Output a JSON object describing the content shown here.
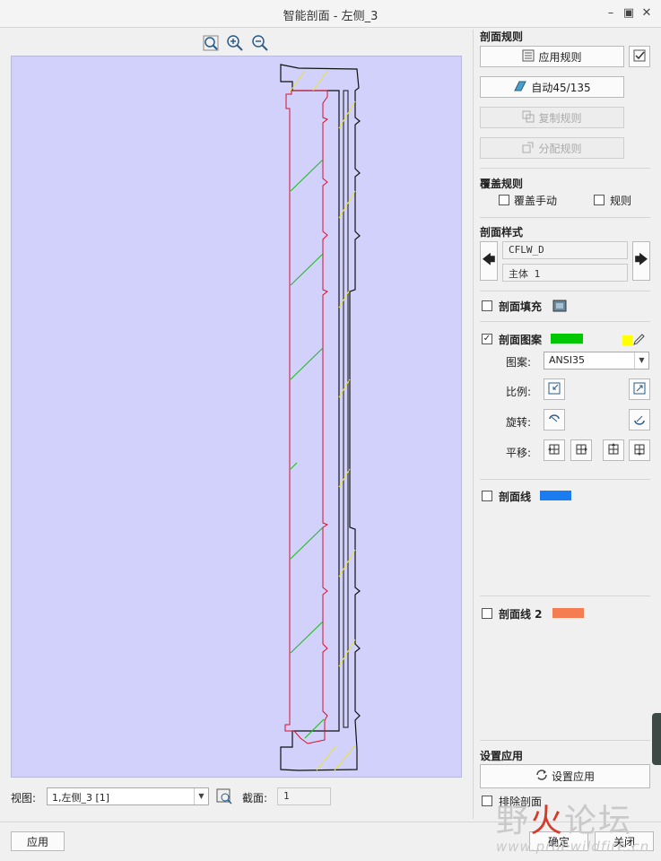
{
  "window": {
    "title": "智能剖面 - 左侧_3"
  },
  "rules": {
    "header": "剖面规则",
    "apply_rules": "应用规则",
    "auto": "自动45/135",
    "copy_rules": "复制规则",
    "assign_rules": "分配规则"
  },
  "override": {
    "header": "覆盖规则",
    "manual": "覆盖手动",
    "rule": "规则"
  },
  "style": {
    "header": "剖面样式",
    "name": "CFLW_D",
    "body": "主体 1"
  },
  "fill": {
    "label": "剖面填充",
    "checked": false
  },
  "pattern": {
    "label": "剖面图案",
    "checked": true,
    "color": "#00c800",
    "edit_color": "#ffff00",
    "pattern_label": "图案:",
    "pattern_value": "ANSI35",
    "scale_label": "比例:",
    "rotate_label": "旋转:",
    "move_label": "平移:"
  },
  "line1": {
    "label": "剖面线",
    "checked": false,
    "color": "#1a7cf0"
  },
  "line2": {
    "label": "剖面线 2",
    "checked": false,
    "color": "#f47e52"
  },
  "apply_setting": {
    "header": "设置应用",
    "button": "设置应用",
    "exclude": "排除剖面"
  },
  "view": {
    "label": "视图:",
    "value": "1,左侧_3 [1]",
    "section_label": "截面:",
    "section_value": "1"
  },
  "footer": {
    "apply": "应用",
    "ok": "确定",
    "close": "关闭"
  },
  "watermark": {
    "text": "野火论坛",
    "url": "www.proewildfire.cn"
  }
}
